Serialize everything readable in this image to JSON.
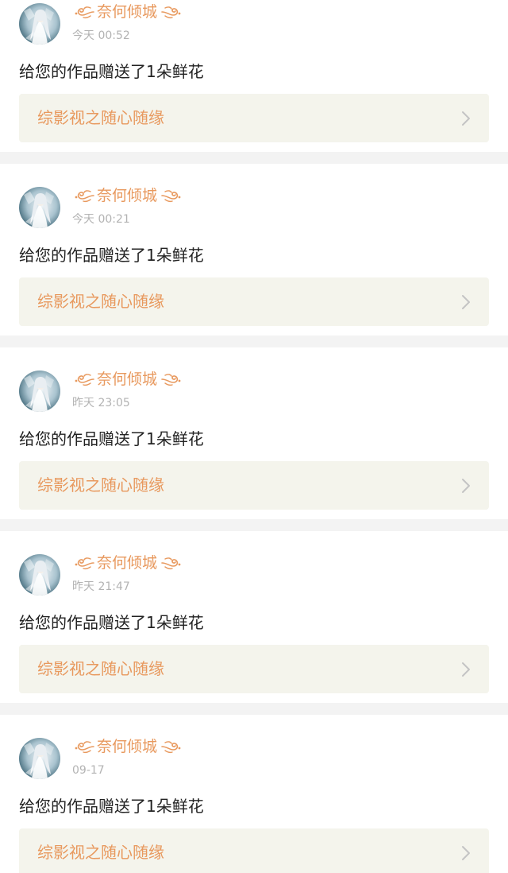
{
  "colors": {
    "accent": "#e8995e",
    "page_background": "#f3f3f3",
    "card_background": "#ffffff",
    "link_background": "#f4f4ec",
    "timestamp": "#b3b3b3",
    "message_text": "#222222",
    "chevron": "#c4c4c4"
  },
  "icons": {
    "avatar": "avatar-image",
    "name_decoration": "swirl-ornament-icon",
    "link_arrow": "chevron-right-icon"
  },
  "notifications": [
    {
      "user_name": "奈何倾城",
      "time": "今天 00:52",
      "message": "给您的作品赠送了1朵鲜花",
      "work_title": "综影视之随心随缘"
    },
    {
      "user_name": "奈何倾城",
      "time": "今天 00:21",
      "message": "给您的作品赠送了1朵鲜花",
      "work_title": "综影视之随心随缘"
    },
    {
      "user_name": "奈何倾城",
      "time": "昨天 23:05",
      "message": "给您的作品赠送了1朵鲜花",
      "work_title": "综影视之随心随缘"
    },
    {
      "user_name": "奈何倾城",
      "time": "昨天 21:47",
      "message": "给您的作品赠送了1朵鲜花",
      "work_title": "综影视之随心随缘"
    },
    {
      "user_name": "奈何倾城",
      "time": "09-17",
      "message": "给您的作品赠送了1朵鲜花",
      "work_title": "综影视之随心随缘"
    }
  ]
}
